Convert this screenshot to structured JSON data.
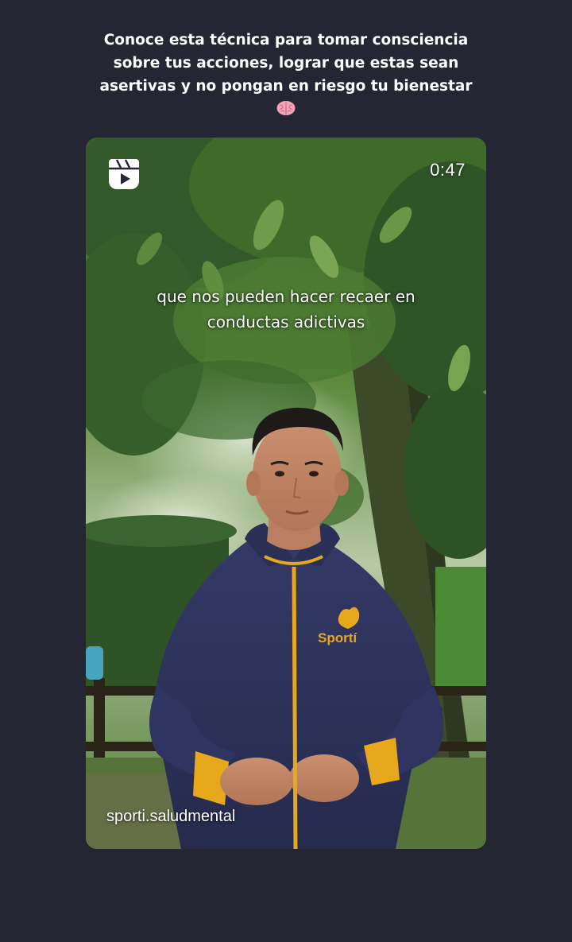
{
  "story": {
    "caption_lines": [
      "Conoce esta técnica para tomar consciencia",
      "sobre tus acciones, lograr que estas sean",
      "asertivas y no pongan en riesgo tu bienestar"
    ],
    "caption_emoji": "brain-emoji"
  },
  "reel": {
    "icon": "reels-icon",
    "duration": "0:47",
    "subtitle_lines": [
      "que nos pueden hacer recaer en",
      "conductas adictivas"
    ],
    "username": "sporti.saludmental",
    "jacket_logo_text": "Sportí"
  },
  "colors": {
    "background": "#242733",
    "jacket": "#2b2f55",
    "jacket_accent": "#e8a81c",
    "foliage": "#3f6b2a"
  }
}
